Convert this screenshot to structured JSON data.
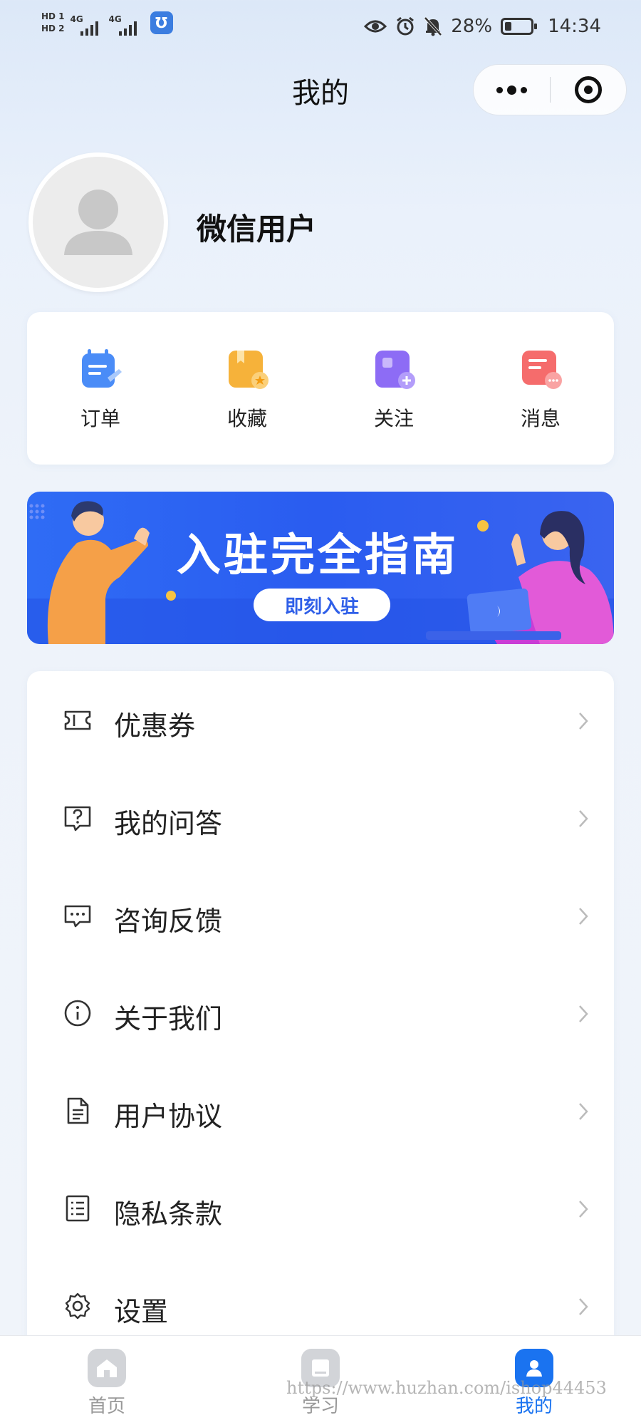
{
  "status_bar": {
    "sim1": "HD 1",
    "sim2": "HD 2",
    "net1": "4G",
    "net2": "4G",
    "battery": "28%",
    "time": "14:34"
  },
  "header": {
    "title": "我的",
    "more_icon": "more-dots-icon",
    "close_icon": "target-close-icon"
  },
  "profile": {
    "name": "微信用户",
    "avatar_icon": "default-avatar-icon"
  },
  "quick_actions": [
    {
      "label": "订单",
      "icon": "order-icon",
      "color": "#4a8cf7"
    },
    {
      "label": "收藏",
      "icon": "favorite-icon",
      "color": "#f6a623"
    },
    {
      "label": "关注",
      "icon": "follow-icon",
      "color": "#8d6cf5"
    },
    {
      "label": "消息",
      "icon": "message-icon",
      "color": "#f56c6c"
    }
  ],
  "banner": {
    "title": "入驻完全指南",
    "button": "即刻入驻"
  },
  "menu": [
    {
      "label": "优惠券",
      "icon": "ticket-icon"
    },
    {
      "label": "我的问答",
      "icon": "question-icon"
    },
    {
      "label": "咨询反馈",
      "icon": "chat-icon"
    },
    {
      "label": "关于我们",
      "icon": "info-icon"
    },
    {
      "label": "用户协议",
      "icon": "document-icon"
    },
    {
      "label": "隐私条款",
      "icon": "list-icon"
    },
    {
      "label": "设置",
      "icon": "gear-icon"
    }
  ],
  "tabbar": [
    {
      "label": "首页",
      "icon": "home-icon",
      "active": false
    },
    {
      "label": "学习",
      "icon": "book-icon",
      "active": false
    },
    {
      "label": "我的",
      "icon": "user-icon",
      "active": true
    }
  ],
  "watermark": "https://www.huzhan.com/ishop44453",
  "colors": {
    "accent": "#1a73f0",
    "banner": "#2f6cf5"
  }
}
